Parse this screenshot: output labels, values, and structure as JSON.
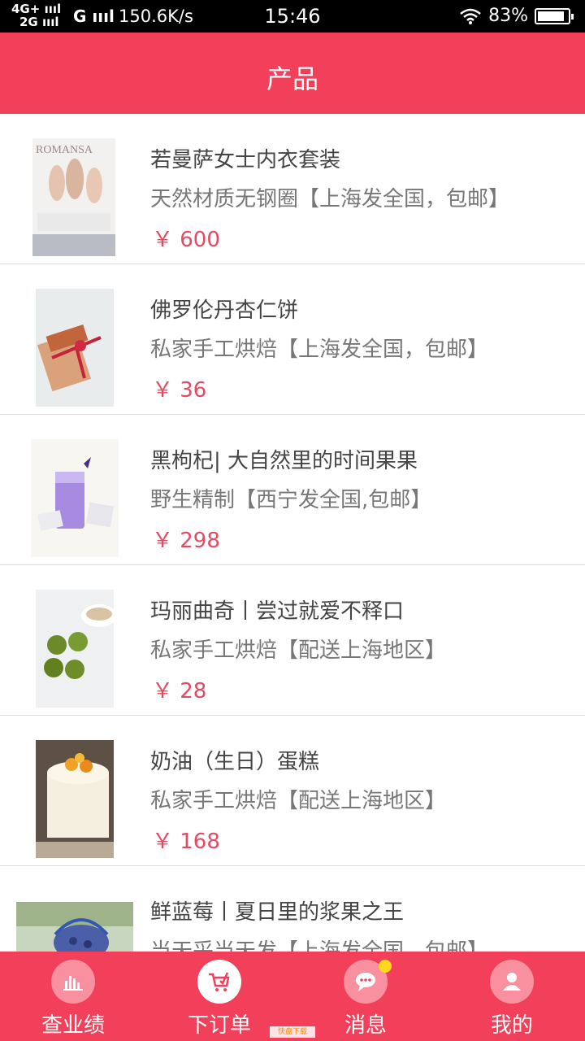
{
  "status_bar": {
    "net_line1": "4G+",
    "net_line2": "2G",
    "network_g": "G",
    "speed": "150.6K/s",
    "time": "15:46",
    "battery": "83%"
  },
  "header": {
    "title": "产品"
  },
  "products": [
    {
      "name": "若曼萨女士内衣套装",
      "desc": "天然材质无钢圈【上海发全国，包邮】",
      "price": "￥ 600",
      "thumb_text": "ROMANSA"
    },
    {
      "name": "佛罗伦丹杏仁饼",
      "desc": "私家手工烘焙【上海发全国，包邮】",
      "price": "￥ 36"
    },
    {
      "name": "黑枸杞| 大自然里的时间果果",
      "desc": "野生精制【西宁发全国,包邮】",
      "price": "￥ 298"
    },
    {
      "name": "玛丽曲奇丨尝过就爱不释口",
      "desc": "私家手工烘焙【配送上海地区】",
      "price": "￥ 28"
    },
    {
      "name": "奶油（生日）蛋糕",
      "desc": "私家手工烘焙【配送上海地区】",
      "price": "￥ 168"
    },
    {
      "name": "鲜蓝莓丨夏日里的浆果之王",
      "desc": "当天采当天发【上海发全国，包邮】",
      "price": ""
    }
  ],
  "bottom_nav": [
    {
      "label": "查业绩",
      "icon": "bar-chart-icon"
    },
    {
      "label": "下订单",
      "icon": "cart-icon"
    },
    {
      "label": "消息",
      "icon": "chat-icon"
    },
    {
      "label": "我的",
      "icon": "user-icon"
    }
  ],
  "watermark": "快盘下载",
  "colors": {
    "accent": "#f2405a",
    "price": "#e34b62",
    "badge": "#ffd71c"
  }
}
